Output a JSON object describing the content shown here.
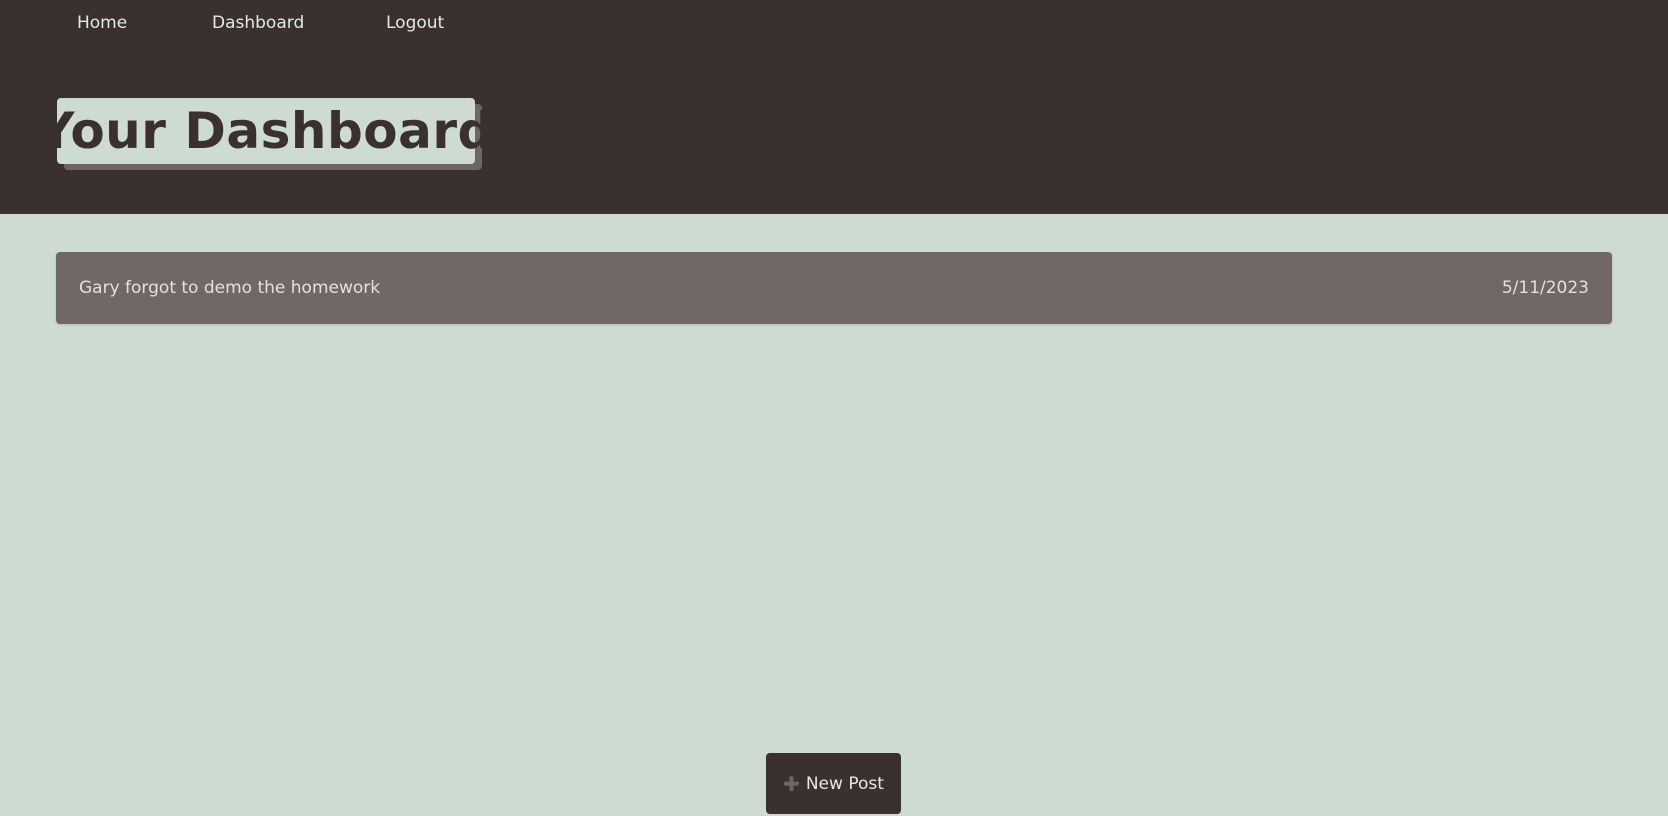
{
  "nav": {
    "home": "Home",
    "dashboard": "Dashboard",
    "logout": "Logout"
  },
  "header": {
    "title": "Your Dashboard"
  },
  "posts": [
    {
      "title": "Gary forgot to demo the homework",
      "date": "5/11/2023"
    }
  ],
  "actions": {
    "new_post_label": "New Post",
    "new_post_icon": "plus-icon"
  },
  "colors": {
    "header_bg": "#3a3030",
    "page_bg": "#cddbd1",
    "card_bg": "#716765",
    "text_light": "#e4e8e2"
  }
}
